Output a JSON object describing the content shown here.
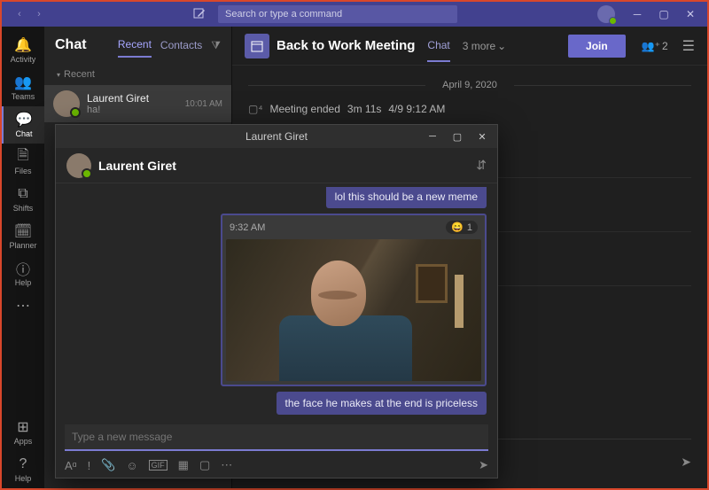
{
  "titlebar": {
    "search_placeholder": "Search or type a command"
  },
  "rail": {
    "items": [
      {
        "label": "Activity"
      },
      {
        "label": "Teams"
      },
      {
        "label": "Chat"
      },
      {
        "label": "Files"
      },
      {
        "label": "Shifts"
      },
      {
        "label": "Planner"
      },
      {
        "label": "Help"
      }
    ],
    "apps_label": "Apps",
    "help2_label": "Help"
  },
  "chatlist": {
    "title": "Chat",
    "tabs": {
      "recent": "Recent",
      "contacts": "Contacts"
    },
    "section": "Recent",
    "conv": {
      "name": "Laurent Giret",
      "preview": "ha!",
      "time": "10:01 AM"
    }
  },
  "main_header": {
    "title": "Back to Work Meeting",
    "tab": "Chat",
    "more": "3 more",
    "join": "Join",
    "people_count": "2"
  },
  "thread": {
    "date": "April 9, 2020",
    "event": {
      "text": "Meeting ended",
      "duration": "3m 11s",
      "time": "4/9 9:12 AM"
    }
  },
  "popout": {
    "title": "Laurent Giret",
    "name": "Laurent Giret",
    "messages": {
      "m1": "lol this should be a new meme",
      "media_time": "9:32 AM",
      "reaction_count": "1",
      "m2": "the face he makes at the end is priceless"
    },
    "compose_placeholder": "Type a new message"
  }
}
